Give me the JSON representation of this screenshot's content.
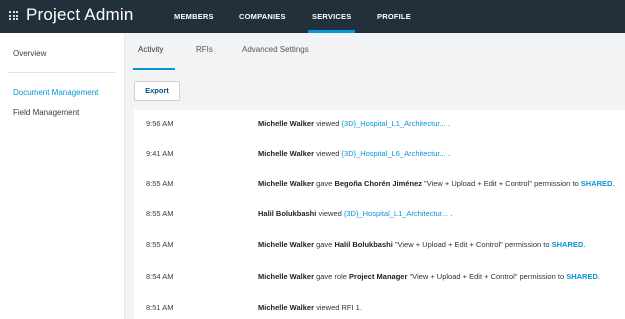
{
  "header": {
    "app_title": "Project Admin",
    "nav": [
      {
        "label": "MEMBERS",
        "active": false
      },
      {
        "label": "COMPANIES",
        "active": false
      },
      {
        "label": "SERVICES",
        "active": true
      },
      {
        "label": "PROFILE",
        "active": false
      }
    ]
  },
  "sidebar": {
    "items": [
      {
        "label": "Overview",
        "active": false
      },
      {
        "label": "Document Management",
        "active": true
      },
      {
        "label": "Field Management",
        "active": false
      }
    ]
  },
  "subtabs": [
    {
      "label": "Activity",
      "active": true
    },
    {
      "label": "RFIs",
      "active": false
    },
    {
      "label": "Advanced Settings",
      "active": false
    }
  ],
  "export_label": "Export",
  "activity": [
    {
      "time": "9:56 AM",
      "actor": "Michelle Walker",
      "t1": " viewed ",
      "link": "{3D}_Hospital_L1_Architectur...",
      "t2": " ."
    },
    {
      "time": "9:41 AM",
      "actor": "Michelle Walker",
      "t1": " viewed ",
      "link": "{3D}_Hospital_L6_Architectur...",
      "t2": " ."
    },
    {
      "time": "8:55 AM",
      "actor": "Michelle Walker",
      "t1": " gave ",
      "target": "Begoña Chorén Jiménez",
      "t2": " \"View + Upload + Edit + Control\" permission to ",
      "folder": "SHARED",
      "t3": "."
    },
    {
      "time": "8:55 AM",
      "actor": "Halil Bolukbashi",
      "t1": " viewed ",
      "link": "{3D}_Hospital_L1_Architectur...",
      "t2": " ."
    },
    {
      "time": "8:55 AM",
      "actor": "Michelle Walker",
      "t1": " gave ",
      "target": "Halil Bolukbashi",
      "t2": " \"View + Upload + Edit + Control\" permission to ",
      "folder": "SHARED",
      "t3": "."
    },
    {
      "time": "8:54 AM",
      "actor": "Michelle Walker",
      "t1": " gave role ",
      "target": "Project Manager",
      "t2": " \"View + Upload + Edit + Control\" permission to ",
      "folder": "SHARED",
      "t3": "."
    },
    {
      "time": "8:51 AM",
      "actor": "Michelle Walker",
      "t1": " viewed RFI 1.",
      "t2": ""
    }
  ]
}
